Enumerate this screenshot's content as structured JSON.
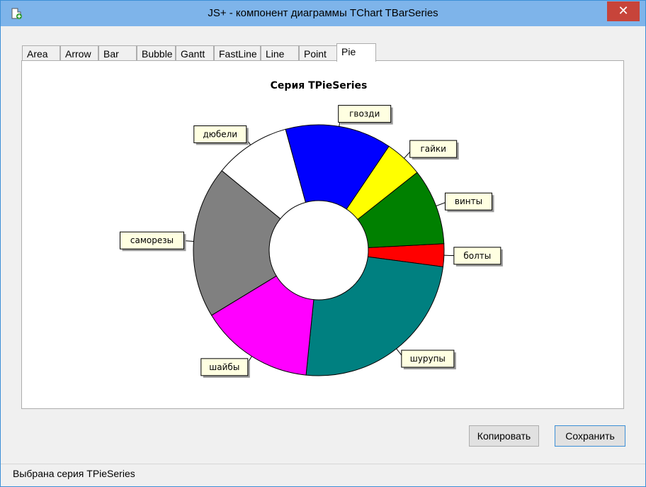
{
  "window": {
    "title": "JS+ - компонент диаграммы TChart TBarSeries",
    "close_glyph": "✕"
  },
  "tabs": [
    {
      "label": "Area"
    },
    {
      "label": "Arrow"
    },
    {
      "label": "Bar"
    },
    {
      "label": "Bubble"
    },
    {
      "label": "Gantt"
    },
    {
      "label": "FastLine"
    },
    {
      "label": "Line"
    },
    {
      "label": "Point"
    },
    {
      "label": "Pie",
      "active": true
    }
  ],
  "chart_data": {
    "type": "pie",
    "title": "Серия TPieSeries",
    "donut": true,
    "slices": [
      {
        "label": "болты",
        "value": 3,
        "color": "#ff0000"
      },
      {
        "label": "шурупы",
        "value": 25,
        "color": "#008080"
      },
      {
        "label": "шайбы",
        "value": 15,
        "color": "#ff00ff"
      },
      {
        "label": "саморезы",
        "value": 20,
        "color": "#808080"
      },
      {
        "label": "дюбели",
        "value": 10,
        "color": "#ffffff"
      },
      {
        "label": "гвозди",
        "value": 14,
        "color": "#0000ff"
      },
      {
        "label": "гайки",
        "value": 5,
        "color": "#ffff00"
      },
      {
        "label": "винты",
        "value": 10,
        "color": "#008000"
      }
    ]
  },
  "buttons": {
    "copy": "Копировать",
    "save": "Сохранить"
  },
  "status": {
    "text": "Выбрана серия TPieSeries"
  }
}
